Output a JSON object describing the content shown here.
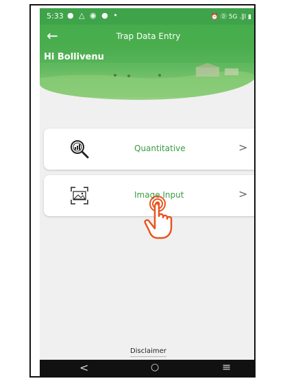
{
  "statusbar": {
    "time": "5:33",
    "left_icons": "● △ ◉ ● •",
    "right_icons": "⏰ Ⓓ 5G .∥l ▮"
  },
  "header": {
    "title": "Trap Data Entry",
    "greeting": "Hi Bollivenu",
    "back_icon": "left-arrow-icon",
    "color": "#46ad4c"
  },
  "options": [
    {
      "label": "Quantitative",
      "icon": "magnifier-chart-icon",
      "chevron": ">"
    },
    {
      "label": "Image Input",
      "icon": "image-scan-icon",
      "chevron": ">"
    }
  ],
  "footer": {
    "disclaimer": "Disclaimer"
  },
  "navbar": {
    "back": "<",
    "home": "○",
    "menu": "≡"
  }
}
